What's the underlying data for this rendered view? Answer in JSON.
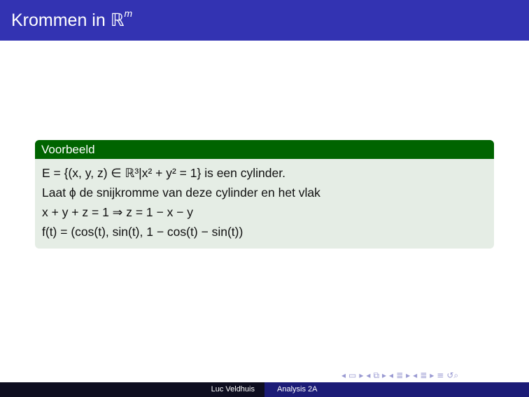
{
  "header": {
    "title_text": "Krommen in ",
    "title_set": "ℝ",
    "title_sup": "m"
  },
  "block": {
    "title": "Voorbeeld",
    "lines": [
      "E = {(x, y, z) ∈ ℝ³|x² + y² = 1} is een cylinder.",
      "Laat ϕ de snijkromme van deze cylinder en het vlak",
      "x + y + z = 1 ⇒ z = 1 − x − y",
      "f(t) = (cos(t), sin(t), 1 − cos(t) − sin(t))"
    ]
  },
  "footer": {
    "author": "Luc Veldhuis",
    "course": "Analysis 2A"
  },
  "nav": {
    "icons": [
      "nav-prev-frame-icon",
      "nav-frame-icon",
      "nav-next-frame-icon",
      "nav-prev-section-icon",
      "nav-section-icon",
      "nav-next-section-icon",
      "nav-prev-subsection-icon",
      "nav-subsection-icon",
      "nav-next-subsection-icon",
      "nav-doc-icon",
      "nav-search-icon"
    ]
  },
  "colors": {
    "header_bg": "#3333b2",
    "block_head_bg": "#006400",
    "block_body_bg": "#e5ede5",
    "footer_left_bg": "#0e0e20",
    "footer_right_bg": "#1c1c77"
  }
}
